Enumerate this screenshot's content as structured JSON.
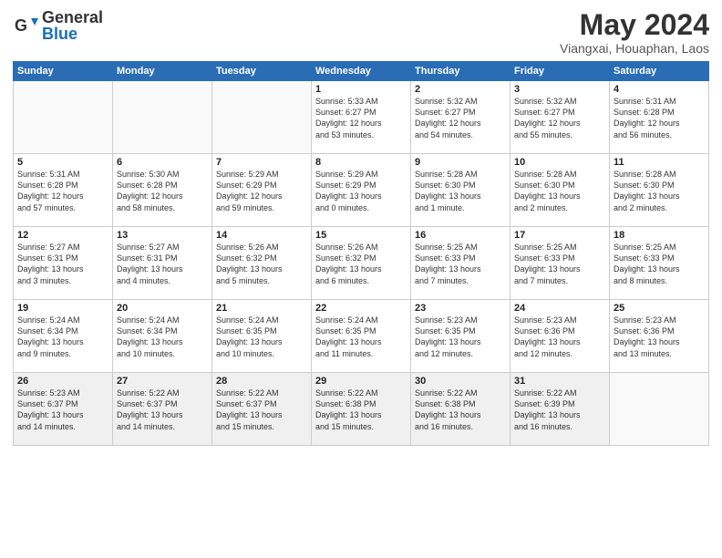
{
  "logo": {
    "general": "General",
    "blue": "Blue"
  },
  "header": {
    "title": "May 2024",
    "subtitle": "Viangxai, Houaphan, Laos"
  },
  "days_of_week": [
    "Sunday",
    "Monday",
    "Tuesday",
    "Wednesday",
    "Thursday",
    "Friday",
    "Saturday"
  ],
  "weeks": [
    [
      {
        "day": "",
        "info": ""
      },
      {
        "day": "",
        "info": ""
      },
      {
        "day": "",
        "info": ""
      },
      {
        "day": "1",
        "info": "Sunrise: 5:33 AM\nSunset: 6:27 PM\nDaylight: 12 hours\nand 53 minutes."
      },
      {
        "day": "2",
        "info": "Sunrise: 5:32 AM\nSunset: 6:27 PM\nDaylight: 12 hours\nand 54 minutes."
      },
      {
        "day": "3",
        "info": "Sunrise: 5:32 AM\nSunset: 6:27 PM\nDaylight: 12 hours\nand 55 minutes."
      },
      {
        "day": "4",
        "info": "Sunrise: 5:31 AM\nSunset: 6:28 PM\nDaylight: 12 hours\nand 56 minutes."
      }
    ],
    [
      {
        "day": "5",
        "info": "Sunrise: 5:31 AM\nSunset: 6:28 PM\nDaylight: 12 hours\nand 57 minutes."
      },
      {
        "day": "6",
        "info": "Sunrise: 5:30 AM\nSunset: 6:28 PM\nDaylight: 12 hours\nand 58 minutes."
      },
      {
        "day": "7",
        "info": "Sunrise: 5:29 AM\nSunset: 6:29 PM\nDaylight: 12 hours\nand 59 minutes."
      },
      {
        "day": "8",
        "info": "Sunrise: 5:29 AM\nSunset: 6:29 PM\nDaylight: 13 hours\nand 0 minutes."
      },
      {
        "day": "9",
        "info": "Sunrise: 5:28 AM\nSunset: 6:30 PM\nDaylight: 13 hours\nand 1 minute."
      },
      {
        "day": "10",
        "info": "Sunrise: 5:28 AM\nSunset: 6:30 PM\nDaylight: 13 hours\nand 2 minutes."
      },
      {
        "day": "11",
        "info": "Sunrise: 5:28 AM\nSunset: 6:30 PM\nDaylight: 13 hours\nand 2 minutes."
      }
    ],
    [
      {
        "day": "12",
        "info": "Sunrise: 5:27 AM\nSunset: 6:31 PM\nDaylight: 13 hours\nand 3 minutes."
      },
      {
        "day": "13",
        "info": "Sunrise: 5:27 AM\nSunset: 6:31 PM\nDaylight: 13 hours\nand 4 minutes."
      },
      {
        "day": "14",
        "info": "Sunrise: 5:26 AM\nSunset: 6:32 PM\nDaylight: 13 hours\nand 5 minutes."
      },
      {
        "day": "15",
        "info": "Sunrise: 5:26 AM\nSunset: 6:32 PM\nDaylight: 13 hours\nand 6 minutes."
      },
      {
        "day": "16",
        "info": "Sunrise: 5:25 AM\nSunset: 6:33 PM\nDaylight: 13 hours\nand 7 minutes."
      },
      {
        "day": "17",
        "info": "Sunrise: 5:25 AM\nSunset: 6:33 PM\nDaylight: 13 hours\nand 7 minutes."
      },
      {
        "day": "18",
        "info": "Sunrise: 5:25 AM\nSunset: 6:33 PM\nDaylight: 13 hours\nand 8 minutes."
      }
    ],
    [
      {
        "day": "19",
        "info": "Sunrise: 5:24 AM\nSunset: 6:34 PM\nDaylight: 13 hours\nand 9 minutes."
      },
      {
        "day": "20",
        "info": "Sunrise: 5:24 AM\nSunset: 6:34 PM\nDaylight: 13 hours\nand 10 minutes."
      },
      {
        "day": "21",
        "info": "Sunrise: 5:24 AM\nSunset: 6:35 PM\nDaylight: 13 hours\nand 10 minutes."
      },
      {
        "day": "22",
        "info": "Sunrise: 5:24 AM\nSunset: 6:35 PM\nDaylight: 13 hours\nand 11 minutes."
      },
      {
        "day": "23",
        "info": "Sunrise: 5:23 AM\nSunset: 6:35 PM\nDaylight: 13 hours\nand 12 minutes."
      },
      {
        "day": "24",
        "info": "Sunrise: 5:23 AM\nSunset: 6:36 PM\nDaylight: 13 hours\nand 12 minutes."
      },
      {
        "day": "25",
        "info": "Sunrise: 5:23 AM\nSunset: 6:36 PM\nDaylight: 13 hours\nand 13 minutes."
      }
    ],
    [
      {
        "day": "26",
        "info": "Sunrise: 5:23 AM\nSunset: 6:37 PM\nDaylight: 13 hours\nand 14 minutes."
      },
      {
        "day": "27",
        "info": "Sunrise: 5:22 AM\nSunset: 6:37 PM\nDaylight: 13 hours\nand 14 minutes."
      },
      {
        "day": "28",
        "info": "Sunrise: 5:22 AM\nSunset: 6:37 PM\nDaylight: 13 hours\nand 15 minutes."
      },
      {
        "day": "29",
        "info": "Sunrise: 5:22 AM\nSunset: 6:38 PM\nDaylight: 13 hours\nand 15 minutes."
      },
      {
        "day": "30",
        "info": "Sunrise: 5:22 AM\nSunset: 6:38 PM\nDaylight: 13 hours\nand 16 minutes."
      },
      {
        "day": "31",
        "info": "Sunrise: 5:22 AM\nSunset: 6:39 PM\nDaylight: 13 hours\nand 16 minutes."
      },
      {
        "day": "",
        "info": ""
      }
    ]
  ]
}
